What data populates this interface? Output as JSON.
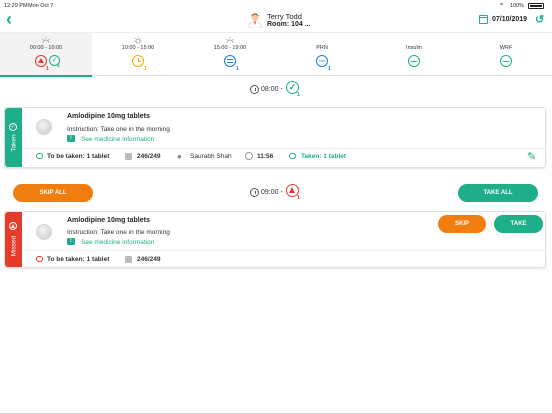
{
  "status": {
    "time": "12:29 PM",
    "date": "Mon Oct 7",
    "battery": "100%"
  },
  "header": {
    "patient_name": "Terry Todd",
    "room": "Room: 104 ...",
    "date": "07/10/2019"
  },
  "tabs": [
    {
      "label": "00:00 - 10:00",
      "counts": [
        "1",
        "1"
      ]
    },
    {
      "label": "10:00 - 15:00",
      "count": "1"
    },
    {
      "label": "15:00 - 19:00",
      "count": "1"
    },
    {
      "label": "PRN",
      "count": "1"
    },
    {
      "label": "Insulin"
    },
    {
      "label": "WRF"
    }
  ],
  "slot1": {
    "time": "08:00 -",
    "count": "1"
  },
  "card1": {
    "status": "Taken",
    "medicine": "Amlodipine 10mg tablets",
    "instruction": "Instruction: Take one in the morning",
    "info_link": "See medicine information",
    "to_be_taken": "To be taken: 1 tablet",
    "stock": "246/249",
    "user": "Saurabh Shah",
    "taken_time": "11:56",
    "taken": "Taken: 1 tablet"
  },
  "actions": {
    "skip_all": "SKIP ALL",
    "take_all": "TAKE ALL"
  },
  "slot2": {
    "time": "09:00 -",
    "count": "1"
  },
  "card2": {
    "status": "Missed",
    "medicine": "Amlodipine 10mg tablets",
    "instruction": "Instruction: Take one in the morning",
    "info_link": "See medicine information",
    "to_be_taken": "To be taken: 1 tablet",
    "stock": "246/249",
    "skip": "SKIP",
    "take": "TAKE"
  },
  "colors": {
    "accent": "#1fae8a",
    "orange": "#f07d0e",
    "missed": "#e53b2a",
    "blue": "#1f7bd8",
    "amber": "#f0b000"
  }
}
